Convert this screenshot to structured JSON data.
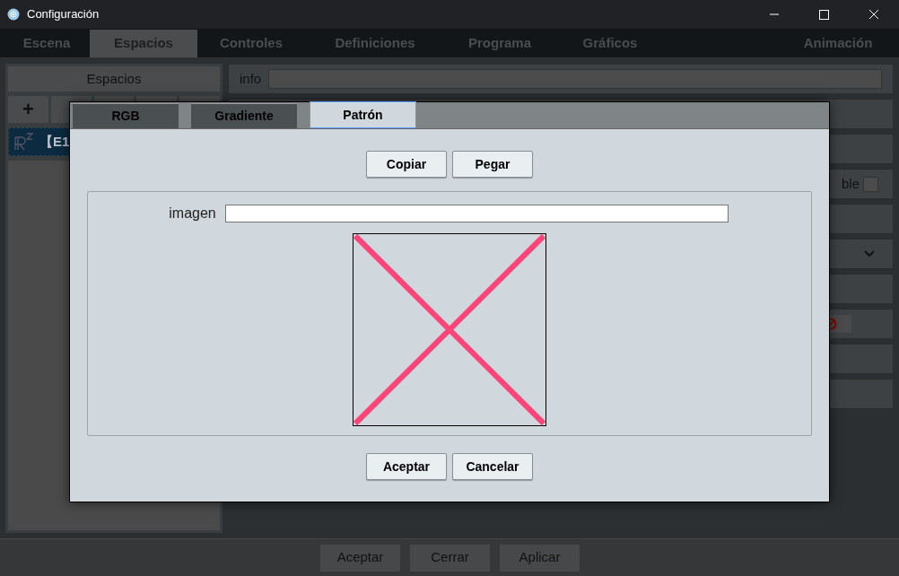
{
  "window": {
    "title": "Configuración"
  },
  "tabs": [
    {
      "label": "Escena",
      "selected": false
    },
    {
      "label": "Espacios",
      "selected": true
    },
    {
      "label": "Controles",
      "selected": false
    },
    {
      "label": "Definiciones",
      "selected": false
    },
    {
      "label": "Programa",
      "selected": false
    },
    {
      "label": "Gráficos",
      "selected": false
    },
    {
      "label": "Animación",
      "selected": false
    }
  ],
  "left_panel": {
    "header": "Espacios",
    "add_button": "+",
    "items": [
      {
        "label": "【E1",
        "selected": true
      }
    ]
  },
  "right_panel": {
    "info_label": "info",
    "partial_label": "ble",
    "checkbox_checked": false
  },
  "dialog": {
    "tabs": [
      {
        "label": "RGB",
        "selected": false
      },
      {
        "label": "Gradiente",
        "selected": false
      },
      {
        "label": "Patrón",
        "selected": true
      }
    ],
    "copy_button": "Copiar",
    "paste_button": "Pegar",
    "image_label": "imagen",
    "ok_button": "Aceptar",
    "cancel_button": "Cancelar"
  },
  "footer_buttons": [
    "Aceptar",
    "Cerrar",
    "Aplicar"
  ]
}
